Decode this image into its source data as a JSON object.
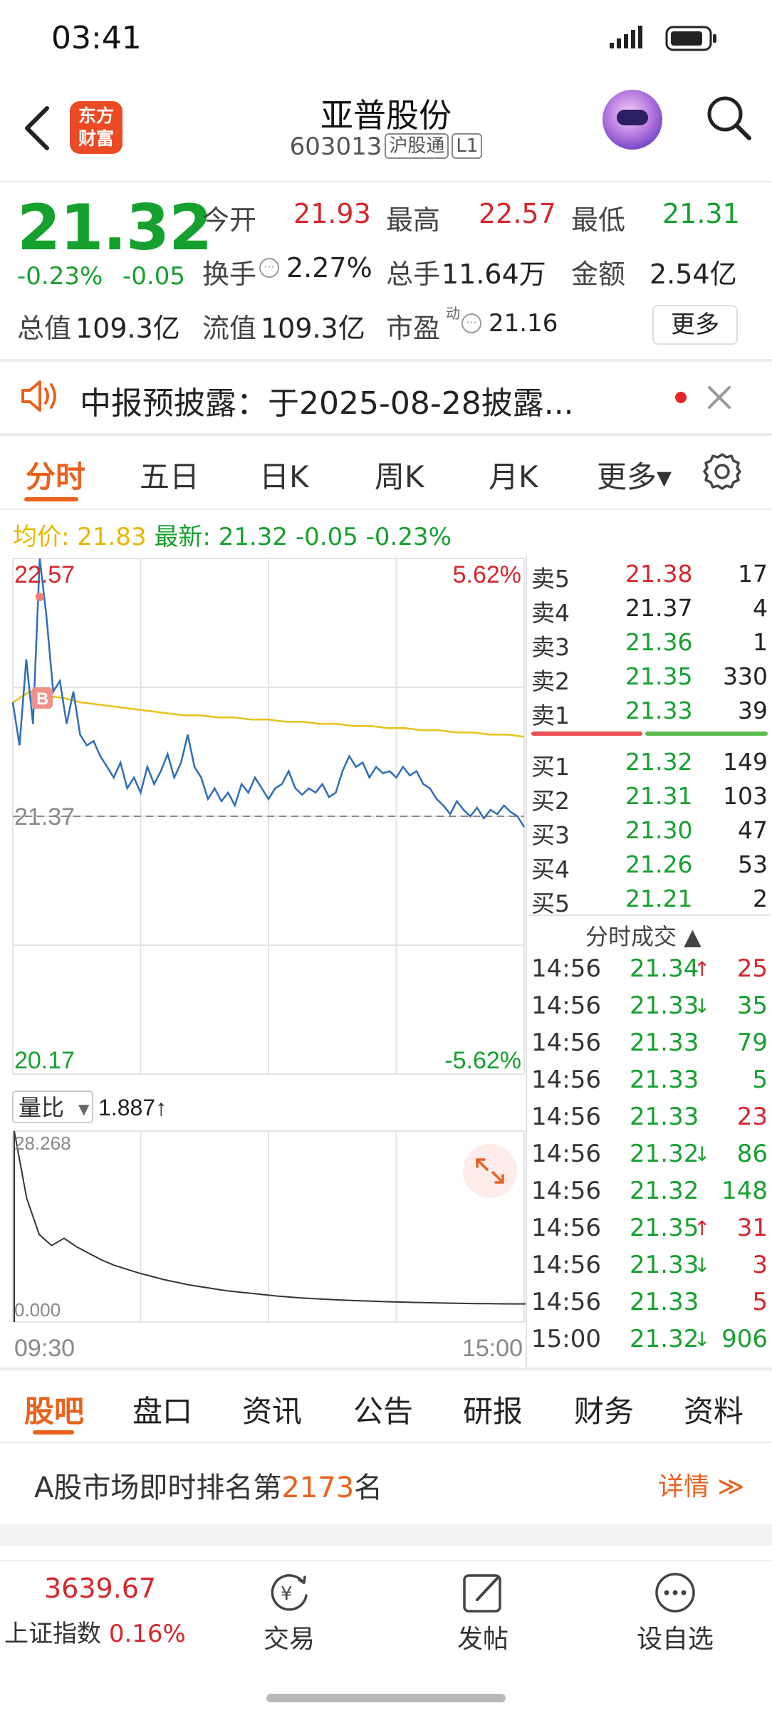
{
  "status_bar": {
    "time": "03:41"
  },
  "header": {
    "logo_line1": "东方",
    "logo_line2": "财富",
    "stock_name": "亚普股份",
    "stock_code": "603013",
    "tag_connect": "沪股通",
    "tag_level": "L1"
  },
  "quote": {
    "price": "21.32",
    "change_pct": "-0.23%",
    "change_amt": "-0.05",
    "open_label": "今开",
    "open_value": "21.93",
    "high_label": "最高",
    "high_value": "22.57",
    "low_label": "最低",
    "low_value": "21.31",
    "turnover_label": "换手",
    "turnover_value": "2.27%",
    "volume_label": "总手",
    "volume_value": "11.64万",
    "amount_label": "金额",
    "amount_value": "2.54亿",
    "mktcap_label": "总值",
    "mktcap_value": "109.3亿",
    "float_label": "流值",
    "float_value": "109.3亿",
    "pe_label": "市盈",
    "pe_sup": "动",
    "pe_value": "21.16",
    "more_label": "更多"
  },
  "notice": {
    "text": "中报预披露：于2025-08-28披露..."
  },
  "chart_tabs": [
    "分时",
    "五日",
    "日K",
    "周K",
    "月K",
    "更多▾"
  ],
  "avg_row": {
    "avg_label": "均价:",
    "avg_value": "21.83",
    "latest_label": "最新:",
    "latest_value": "21.32 -0.05 -0.23%"
  },
  "chart_data": {
    "type": "line",
    "title": "",
    "xlabel": "",
    "ylabel": "",
    "x_ticks": [
      "09:30",
      "15:00"
    ],
    "ylim": [
      20.17,
      22.57
    ],
    "y_labels_left": [
      "22.57",
      "21.37",
      "20.17"
    ],
    "y_labels_right": [
      "5.62%",
      "-5.62%"
    ],
    "prev_close": 21.37,
    "series": [
      {
        "values": [
          21.9,
          21.7,
          22.1,
          21.8,
          22.57,
          22.3,
          21.95,
          22.0,
          21.8,
          21.95,
          21.75,
          21.7,
          21.72,
          21.65,
          21.6,
          21.55,
          21.62,
          21.5,
          21.55,
          21.48,
          21.6,
          21.52,
          21.58,
          21.66,
          21.55,
          21.62,
          21.75,
          21.6,
          21.55,
          21.45,
          21.5,
          21.44,
          21.48,
          21.42,
          21.52,
          21.48,
          21.55,
          21.5,
          21.45,
          21.5,
          21.52,
          21.58,
          21.5,
          21.47,
          21.5,
          21.48,
          21.52,
          21.46,
          21.48,
          21.58,
          21.65,
          21.6,
          21.62,
          21.55,
          21.6,
          21.57,
          21.58,
          21.55,
          21.6,
          21.56,
          21.58,
          21.52,
          21.5,
          21.45,
          21.42,
          21.38,
          21.44,
          21.4,
          21.37,
          21.41,
          21.36,
          21.4,
          21.38,
          21.42,
          21.39,
          21.37,
          21.32
        ]
      },
      {
        "values": [
          21.9,
          21.95,
          21.93,
          21.92,
          21.9,
          21.89,
          21.88,
          21.87,
          21.86,
          21.85,
          21.84,
          21.84,
          21.83,
          21.83,
          21.82,
          21.82,
          21.81,
          21.81,
          21.8,
          21.8,
          21.79,
          21.79,
          21.78,
          21.78,
          21.77,
          21.77,
          21.76,
          21.76,
          21.75,
          21.75,
          21.74
        ]
      }
    ],
    "volume_ratio": {
      "label": "量比",
      "value": "1.887↑",
      "ylim": [
        0.0,
        28.268
      ],
      "y_labels": [
        "28.268",
        "0.000"
      ],
      "values": [
        28.268,
        18.0,
        12.5,
        10.8,
        11.9,
        10.6,
        9.6,
        8.6,
        7.8,
        7.2,
        6.6,
        6.1,
        5.6,
        5.2,
        4.8,
        4.5,
        4.2,
        3.9,
        3.7,
        3.5,
        3.3,
        3.1,
        2.95,
        2.8,
        2.7,
        2.6,
        2.5,
        2.42,
        2.35,
        2.28,
        2.22,
        2.17,
        2.12,
        2.08,
        2.04,
        2.0,
        1.97,
        1.94,
        1.92,
        1.9,
        1.89,
        1.887
      ]
    }
  },
  "order_book": {
    "asks": [
      {
        "label": "卖5",
        "price": "21.38",
        "vol": "17",
        "color": "#d6262c"
      },
      {
        "label": "卖4",
        "price": "21.37",
        "vol": "4",
        "color": "#222222"
      },
      {
        "label": "卖3",
        "price": "21.36",
        "vol": "1",
        "color": "#16a02e"
      },
      {
        "label": "卖2",
        "price": "21.35",
        "vol": "330",
        "color": "#16a02e"
      },
      {
        "label": "卖1",
        "price": "21.33",
        "vol": "39",
        "color": "#16a02e"
      }
    ],
    "bids": [
      {
        "label": "买1",
        "price": "21.32",
        "vol": "149",
        "color": "#16a02e"
      },
      {
        "label": "买2",
        "price": "21.31",
        "vol": "103",
        "color": "#16a02e"
      },
      {
        "label": "买3",
        "price": "21.30",
        "vol": "47",
        "color": "#16a02e"
      },
      {
        "label": "买4",
        "price": "21.26",
        "vol": "53",
        "color": "#16a02e"
      },
      {
        "label": "买5",
        "price": "21.21",
        "vol": "2",
        "color": "#16a02e"
      }
    ]
  },
  "trades": {
    "header": "分时成交 ▲",
    "rows": [
      {
        "time": "14:56",
        "price": "21.34",
        "arrow": "↑",
        "vol": "25",
        "vcolor": "#d6262c",
        "acolor": "#d6262c"
      },
      {
        "time": "14:56",
        "price": "21.33",
        "arrow": "↓",
        "vol": "35",
        "vcolor": "#16a02e",
        "acolor": "#16a02e"
      },
      {
        "time": "14:56",
        "price": "21.33",
        "arrow": "",
        "vol": "79",
        "vcolor": "#16a02e",
        "acolor": "#16a02e"
      },
      {
        "time": "14:56",
        "price": "21.33",
        "arrow": "",
        "vol": "5",
        "vcolor": "#16a02e",
        "acolor": "#16a02e"
      },
      {
        "time": "14:56",
        "price": "21.33",
        "arrow": "",
        "vol": "23",
        "vcolor": "#d6262c",
        "acolor": "#d6262c"
      },
      {
        "time": "14:56",
        "price": "21.32",
        "arrow": "↓",
        "vol": "86",
        "vcolor": "#16a02e",
        "acolor": "#16a02e"
      },
      {
        "time": "14:56",
        "price": "21.32",
        "arrow": "",
        "vol": "148",
        "vcolor": "#16a02e",
        "acolor": "#16a02e"
      },
      {
        "time": "14:56",
        "price": "21.35",
        "arrow": "↑",
        "vol": "31",
        "vcolor": "#d6262c",
        "acolor": "#d6262c"
      },
      {
        "time": "14:56",
        "price": "21.33",
        "arrow": "↓",
        "vol": "3",
        "vcolor": "#d6262c",
        "acolor": "#16a02e"
      },
      {
        "time": "14:56",
        "price": "21.33",
        "arrow": "",
        "vol": "5",
        "vcolor": "#d6262c",
        "acolor": "#16a02e"
      },
      {
        "time": "15:00",
        "price": "21.32",
        "arrow": "↓",
        "vol": "906",
        "vcolor": "#16a02e",
        "acolor": "#16a02e"
      }
    ]
  },
  "bottom_tabs": [
    "股吧",
    "盘口",
    "资讯",
    "公告",
    "研报",
    "财务",
    "资料"
  ],
  "rank": {
    "prefix": "A股市场即时排名第",
    "number": "2173",
    "suffix": "名",
    "detail": "详情 ≫"
  },
  "bottom_nav": {
    "index_value": "3639.67",
    "index_name": "上证指数",
    "index_change": "0.16%",
    "trade": "交易",
    "post": "发帖",
    "watchlist": "设自选"
  }
}
